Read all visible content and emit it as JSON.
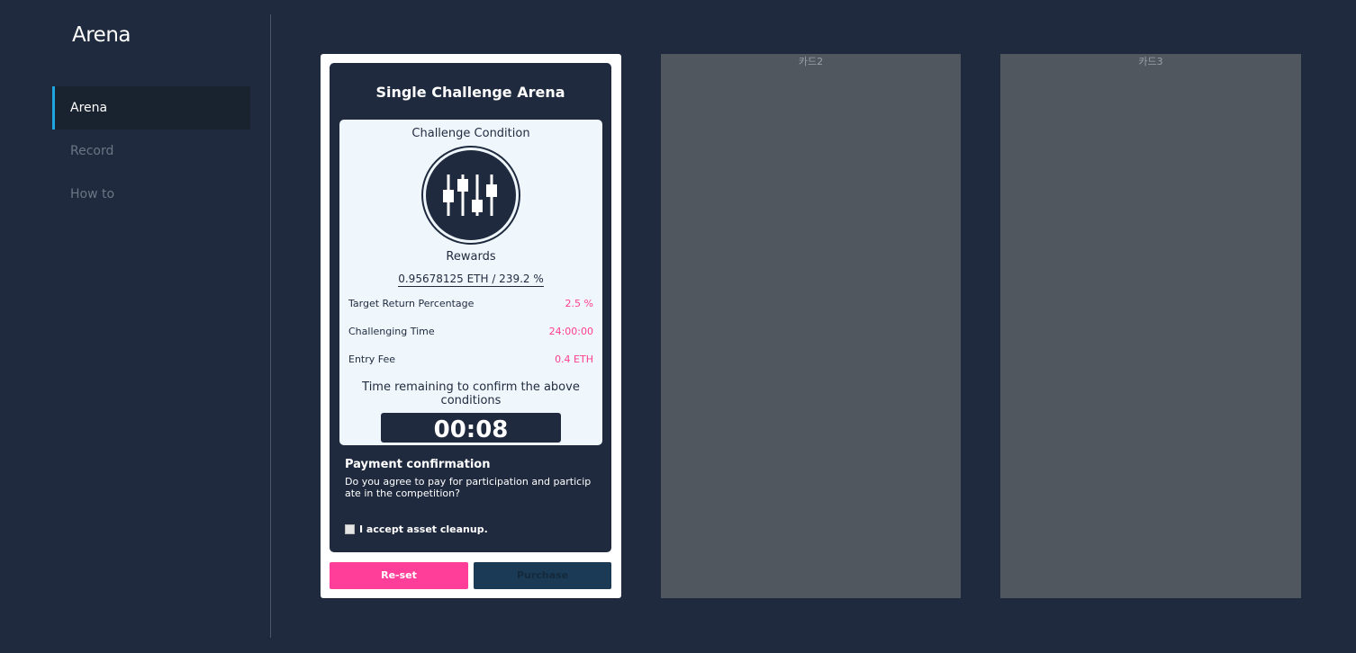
{
  "app": {
    "title": "Arena"
  },
  "sidebar": {
    "items": [
      {
        "label": "Arena",
        "active": true
      },
      {
        "label": "Record",
        "active": false
      },
      {
        "label": "How to",
        "active": false
      }
    ]
  },
  "card1": {
    "title": "Single Challenge Arena",
    "condition_title": "Challenge Condition",
    "icon": "sliders-icon",
    "rewards_label": "Rewards",
    "rewards_value": "0.95678125 ETH / 239.2 %",
    "rows": [
      {
        "label": "Target Return Percentage",
        "value": "2.5 %"
      },
      {
        "label": "Challenging Time",
        "value": "24:00:00"
      },
      {
        "label": "Entry Fee",
        "value": "0.4 ETH"
      }
    ],
    "time_label": "Time remaining to confirm the above conditions",
    "timer": "00:08",
    "payment_title": "Payment confirmation",
    "payment_text": "Do you agree to pay for participation and participate in the competition?",
    "accept_label": "I accept asset cleanup.",
    "accept_checked": false,
    "reset_label": "Re-set",
    "purchase_label": "Purchase"
  },
  "card2": {
    "label": "카드2"
  },
  "card3": {
    "label": "카드3"
  },
  "colors": {
    "background": "#1f2a3e",
    "accent_pink": "#ff3e9a",
    "accent_blue": "#1ea6e0",
    "placeholder_card": "#50575f"
  }
}
